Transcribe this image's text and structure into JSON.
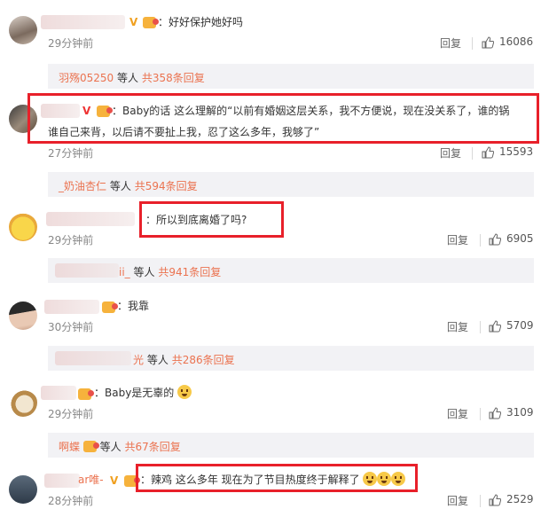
{
  "comments": [
    {
      "text": "：好好保护她好吗",
      "time": "29分钟前",
      "reply_label": "回复",
      "likes": "16086"
    },
    {
      "text_line1": "：Baby的话 这么理解的“以前有婚姻这层关系，我不方便说，现在没关系了，谁的锅",
      "text_line2": "谁自己来背，以后请不要扯上我，忍了这么多年，我够了”",
      "time": "27分钟前",
      "reply_label": "回复",
      "likes": "15593"
    },
    {
      "text": "：所以到底离婚了吗?",
      "time": "29分钟前",
      "reply_label": "回复",
      "likes": "6905"
    },
    {
      "text": "：我靠",
      "time": "30分钟前",
      "reply_label": "回复",
      "likes": "5709"
    },
    {
      "text": "：Baby是无辜的",
      "time": "29分钟前",
      "reply_label": "回复",
      "likes": "3109"
    },
    {
      "name_suffix": "ar唯-",
      "text": "：辣鸡 这么多年 现在为了节目热度终于解释了",
      "time": "28分钟前",
      "reply_label": "回复",
      "likes": "2529"
    }
  ],
  "subreplies": [
    {
      "name": "羽殇05250",
      "mid": "等人",
      "count": "共358条回复"
    },
    {
      "name": "_奶油杏仁",
      "mid": "等人",
      "count": "共594条回复"
    },
    {
      "name": "ii_",
      "mid": "等人",
      "count": "共941条回复"
    },
    {
      "name": "光",
      "mid": "等人",
      "count": "共286条回复"
    },
    {
      "name": "啊蝶",
      "mid": "等人",
      "count": "共67条回复"
    }
  ],
  "colors": {
    "accent": "#eb7350",
    "highlight_box": "#e8202a",
    "subbar_bg": "#f2f2f5"
  },
  "icons": {
    "like": "thumb-up-icon",
    "verified": "v-badge-icon",
    "member": "member-badge-icon",
    "emoji": "smiley-emoji-icon"
  }
}
